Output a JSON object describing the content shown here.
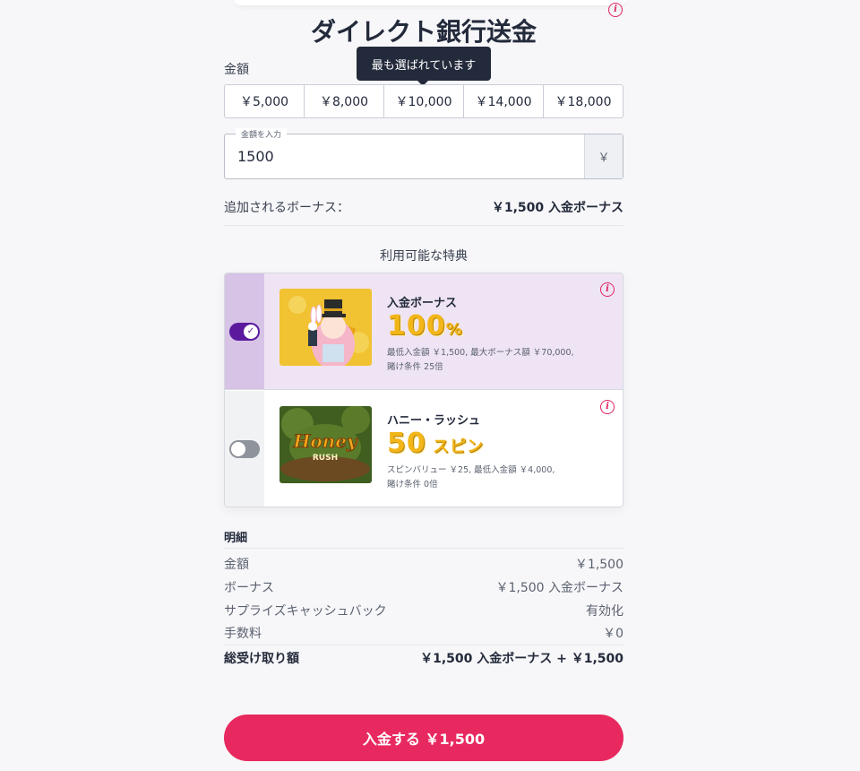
{
  "header": {
    "title": "ダイレクト銀行送金"
  },
  "amount": {
    "label": "金額",
    "tooltip": "最も選ばれています",
    "presets": [
      "￥5,000",
      "￥8,000",
      "￥10,000",
      "￥14,000",
      "￥18,000"
    ],
    "input_legend": "金額を入力",
    "input_value": "1500",
    "currency": "￥"
  },
  "bonus_added": {
    "label": "追加されるボーナス：",
    "value": "￥1,500 入金ボーナス"
  },
  "offers": {
    "title": "利用可能な特典",
    "items": [
      {
        "name": "入金ボーナス",
        "big": "100",
        "big_suffix": "%",
        "desc1": "最低入金額 ￥1,500, 最大ボーナス額 ￥70,000,",
        "desc2": "賭け条件 25倍",
        "enabled": true
      },
      {
        "name": "ハニー・ラッシュ",
        "big": "50",
        "big_suffix": " スピン",
        "desc1": "スピンバリュー ￥25, 最低入金額 ￥4,000,",
        "desc2": "賭け条件 0倍",
        "thumb_text1": "Honey",
        "thumb_text2": "RUSH",
        "enabled": false
      }
    ]
  },
  "breakdown": {
    "title": "明細",
    "rows": [
      {
        "label": "金額",
        "value": "￥1,500"
      },
      {
        "label": "ボーナス",
        "value": "￥1,500 入金ボーナス"
      },
      {
        "label": "サプライズキャッシュバック",
        "value": "有効化"
      },
      {
        "label": "手数料",
        "value": "￥0"
      }
    ],
    "total_label": "総受け取り額",
    "total_value": "￥1,500 入金ボーナス + ￥1,500"
  },
  "deposit_button": "入金する ￥1,500",
  "colors": {
    "accent": "#e8295f",
    "toggle_on": "#5b1a9e",
    "selected_bg": "#efe4f4"
  }
}
